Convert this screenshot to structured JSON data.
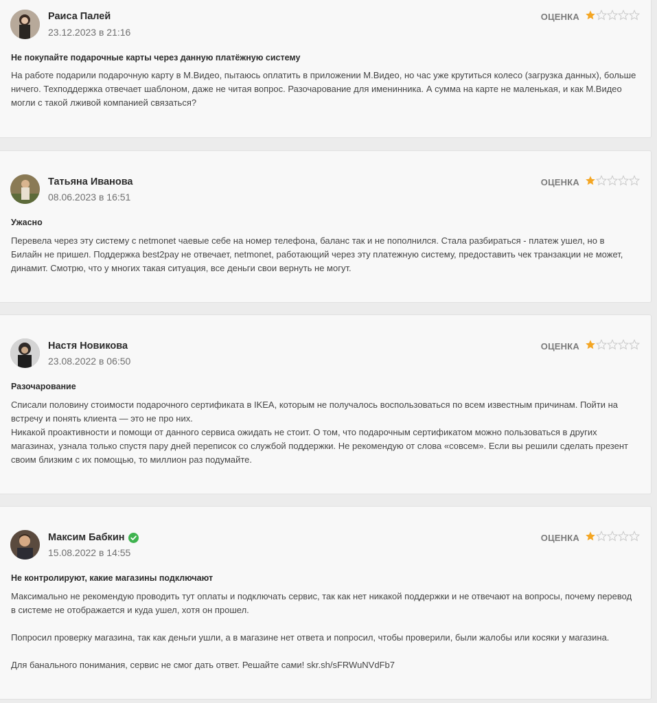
{
  "rating_label": "ОЦЕНКА",
  "colors": {
    "star_filled": "#f4a623",
    "star_empty": "#c9c9c9",
    "verified": "#3fb34f"
  },
  "reviews": [
    {
      "author": "Раиса Палей",
      "date": "23.12.2023 в 21:16",
      "rating": 1,
      "title": "Не покупайте подарочные карты через данную платёжную систему",
      "paragraphs": [
        "На работе подарили подарочную карту в М.Видео, пытаюсь оплатить в приложении М.Видео, но час уже крутиться колесо (загрузка данных), больше ничего. Техподдержка отвечает шаблоном, даже не читая вопрос. Разочарование для именинника. А сумма на карте не маленькая, и как М.Видео могли с такой лживой компанией связаться?"
      ]
    },
    {
      "author": "Татьяна Иванова",
      "date": "08.06.2023 в 16:51",
      "rating": 1,
      "title": "Ужасно",
      "paragraphs": [
        "Перевела через эту систему с netmonet чаевые себе на номер телефона, баланс так и не пополнился. Стала разбираться - платеж ушел, но в Билайн не пришел. Поддержка best2pay не отвечает, netmonet, работающий через эту платежную систему, предоставить чек транзакции не может, динамит. Смотрю, что у многих такая ситуация, все деньги свои вернуть не могут."
      ]
    },
    {
      "author": "Настя Новикова",
      "date": "23.08.2022 в 06:50",
      "rating": 1,
      "title": "Разочарование",
      "paragraphs": [
        "Списали половину стоимости подарочного сертификата в IKEA, которым не получалось воспользоваться по всем известным причинам. Пойти на встречу и понять клиента — это не про них.",
        "Никакой проактивности и помощи от данного сервиса ожидать не стоит. О том, что подарочным сертификатом можно пользоваться в других магазинах, узнала только спустя пару дней переписок со службой поддержки. Не рекомендую от слова «совсем». Если вы решили сделать презент своим близким с их помощью, то миллион раз подумайте."
      ]
    },
    {
      "author": "Максим Бабкин",
      "date": "15.08.2022 в 14:55",
      "rating": 1,
      "verified": true,
      "title": "Не контролируют, какие магазины подключают",
      "paragraphs": [
        "Максимально не рекомендую проводить тут оплаты и подключать сервис, так как нет никакой поддержки и не отвечают на вопросы, почему перевод в системе не отображается и куда ушел, хотя он прошел.",
        "Попросил проверку магазина, так как деньги ушли, а в магазине нет ответа и попросил, чтобы проверили, были жалобы или косяки у магазина.",
        "Для банального понимания, сервис не смог дать ответ. Решайте сами! skr.sh/sFRWuNVdFb7"
      ]
    }
  ]
}
